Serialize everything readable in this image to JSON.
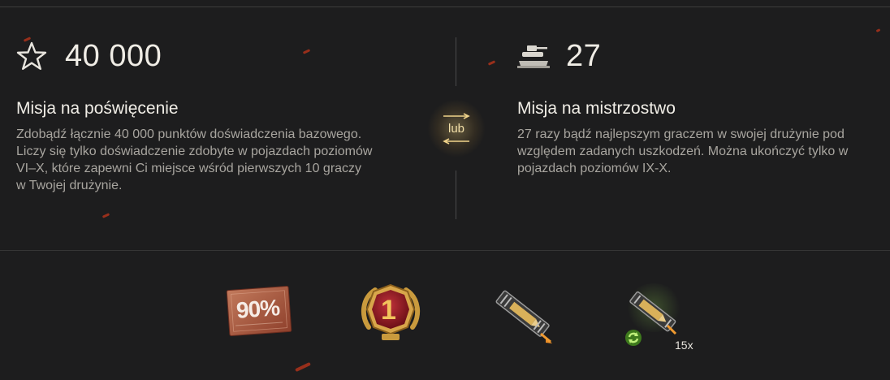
{
  "mission_left": {
    "value": "40 000",
    "icon": "star-outline-icon",
    "title": "Misja na poświęcenie",
    "description": "Zdobądź łącznie 40 000 punktów doświadczenia bazowego. Liczy się tylko doświadczenie zdobyte w pojazdach poziomów VI–X, które zapewni Ci miejsce wśród pierwszych 10 graczy w Twojej drużynie."
  },
  "separator": {
    "label": "lub"
  },
  "mission_right": {
    "value": "27",
    "icon": "tank-on-podium-icon",
    "title": "Misja na mistrzostwo",
    "description": "27 razy bądź najlepszym graczem w swojej drużynie pod względem zadanych uszkodzeń. Można ukończyć tylko w pojazdach poziomów IX-X."
  },
  "rewards": [
    {
      "name": "discount-card",
      "label": "90%"
    },
    {
      "name": "rank-1-medal",
      "label": "1"
    },
    {
      "name": "ammo-booster",
      "label": ""
    },
    {
      "name": "ammo-booster-reusable",
      "label": "",
      "count": "15x"
    }
  ],
  "colors": {
    "background": "#1d1d1e",
    "text_primary": "#f0ede6",
    "text_secondary": "#a8a59f",
    "accent_gold": "#e0b552",
    "ember_red": "#c2361b"
  }
}
